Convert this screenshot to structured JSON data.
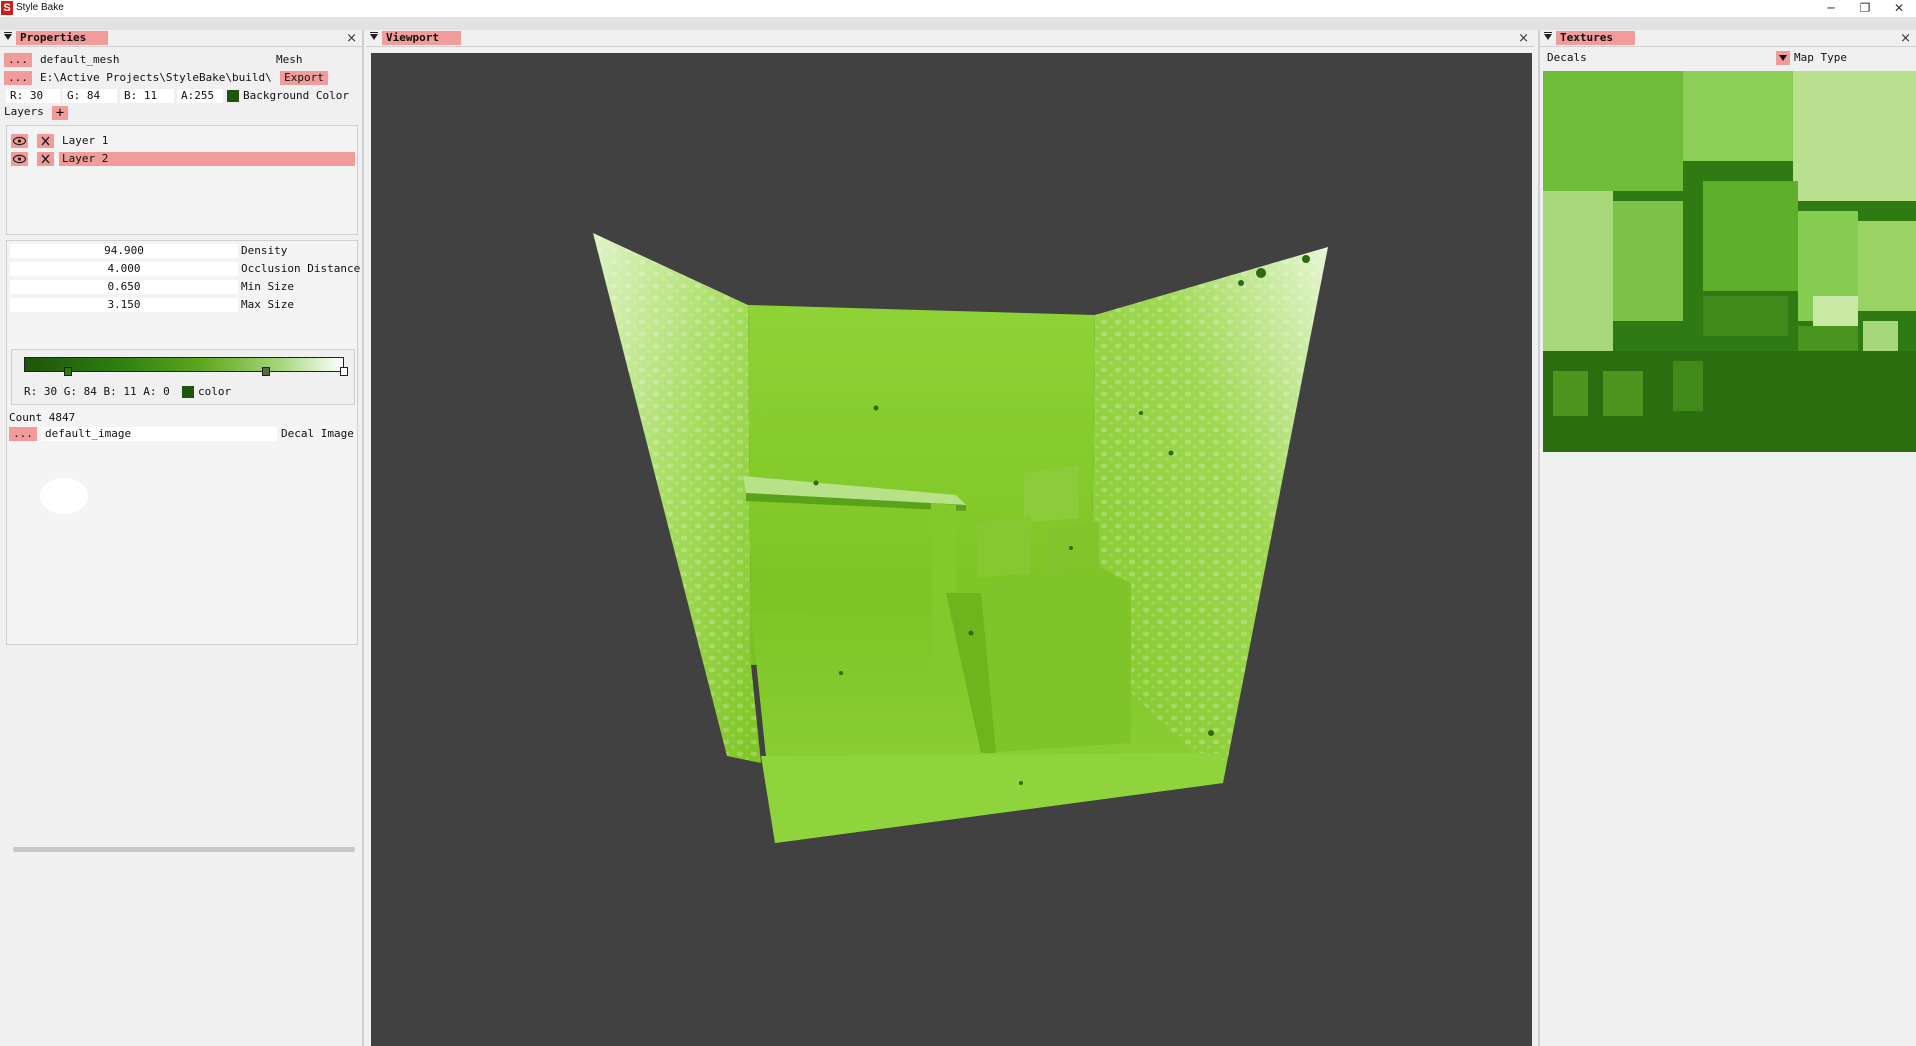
{
  "window": {
    "title": "Style Bake",
    "icon_letter": "S",
    "minimize_glyph": "─",
    "maximize_glyph": "❐",
    "close_glyph": "✕"
  },
  "properties": {
    "tab": "Properties",
    "close_glyph": "×",
    "browse_label": "...",
    "mesh_value": "default_mesh",
    "mesh_label": "Mesh",
    "export_path": "E:\\Active Projects\\StyleBake\\build\\",
    "export_label": "Export",
    "bg_r": "R: 30",
    "bg_g": "G: 84",
    "bg_b": "B: 11",
    "bg_a": "A:255",
    "bg_label": "Background Color",
    "bg_color": "#1e540b",
    "layers_label": "Layers",
    "add_layer_glyph": "+",
    "layers": [
      {
        "name": "Layer 1",
        "selected": false
      },
      {
        "name": "Layer 2",
        "selected": true
      }
    ],
    "params": [
      {
        "value": "94.900",
        "label": "Density"
      },
      {
        "value": "4.000",
        "label": "Occlusion Distance"
      },
      {
        "value": "0.650",
        "label": "Min Size"
      },
      {
        "value": "3.150",
        "label": "Max Size"
      }
    ],
    "gradient_color_text": "R: 30 G: 84 B: 11 A:  0",
    "gradient_color_label": "color",
    "gradient_color": "#1e540b",
    "count_label": "Count 4847",
    "decal_image_value": "default_image",
    "decal_image_label": "Decal Image"
  },
  "viewport": {
    "tab": "Viewport",
    "close_glyph": "×",
    "background_color": "#414141"
  },
  "textures": {
    "tab": "Textures",
    "close_glyph": "×",
    "selected_texture": "Decals",
    "map_type_label": "Map Type"
  },
  "colors": {
    "accent": "#f29b9b",
    "dark_green": "#1e540b",
    "mid_green": "#5ea61d",
    "light_green": "#8fd23a"
  }
}
